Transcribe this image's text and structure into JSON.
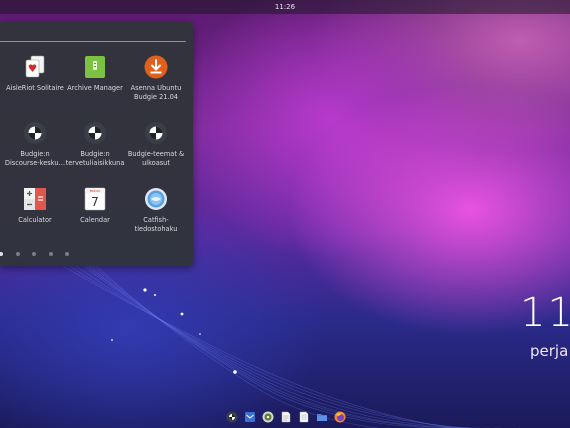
{
  "topbar": {
    "time": "11:26"
  },
  "menu": {
    "apps": [
      {
        "label": "AisleRiot Solitaire",
        "icon": "cards-icon"
      },
      {
        "label": "Archive Manager",
        "icon": "archive-icon"
      },
      {
        "label": "Asenna Ubuntu Budgie 21.04",
        "icon": "install-icon"
      },
      {
        "label": "Budgie:n Discourse-kesku…",
        "icon": "budgie-icon"
      },
      {
        "label": "Budgie:n tervetuliaisikkuna",
        "icon": "budgie-icon"
      },
      {
        "label": "Budgie-teemat & ulkoasut",
        "icon": "budgie-icon"
      },
      {
        "label": "Calculator",
        "icon": "calculator-icon"
      },
      {
        "label": "Calendar",
        "icon": "calendar-icon"
      },
      {
        "label": "Catfish-tiedostohaku",
        "icon": "search-icon"
      }
    ],
    "calendar_month": "FRIDAY",
    "calendar_day": "7",
    "pages": 5,
    "active_page": 1
  },
  "desktop": {
    "clock": "11",
    "day": "perja"
  },
  "dock": {
    "icons": [
      "budgie-icon",
      "mail-icon",
      "disk-icon",
      "document-icon",
      "text-editor-icon",
      "folder-icon",
      "firefox-icon"
    ]
  },
  "colors": {
    "accent": "#5a9fd6",
    "menu_bg": "#30343a"
  }
}
